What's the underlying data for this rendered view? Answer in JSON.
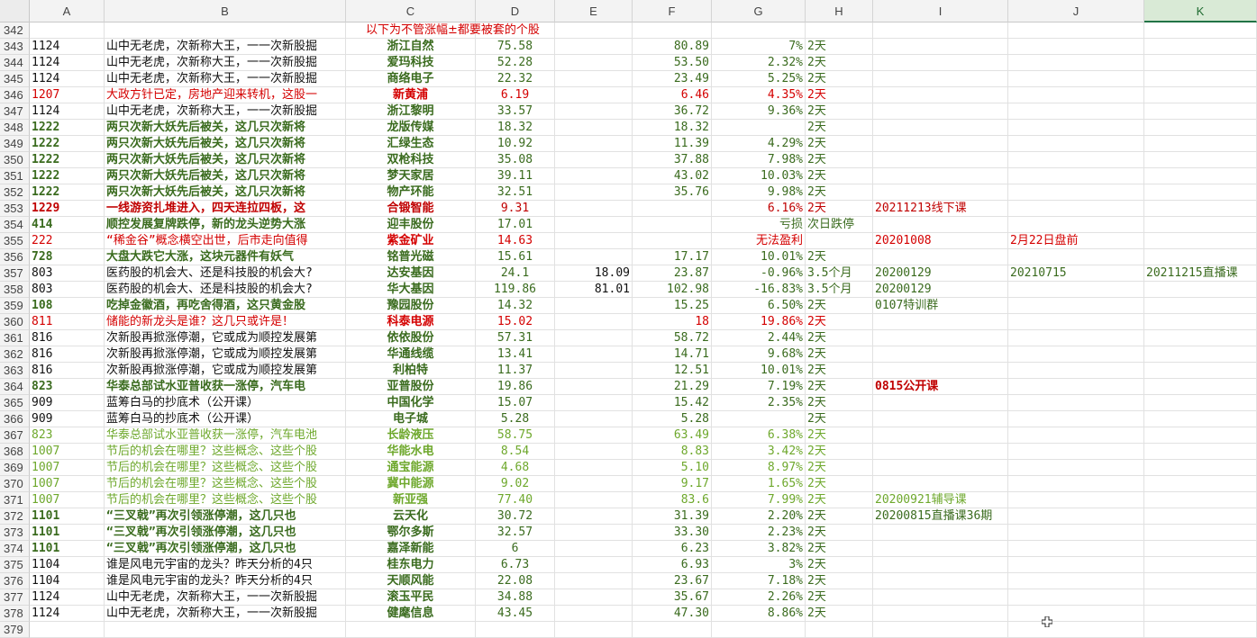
{
  "columns": [
    "A",
    "B",
    "C",
    "D",
    "E",
    "F",
    "G",
    "H",
    "I",
    "J",
    "K"
  ],
  "banner": "以下为不管涨幅±都要被套的个股",
  "rows": [
    {
      "n": "342",
      "a": "",
      "b": "",
      "c": "",
      "d": "",
      "e": "",
      "f": "",
      "g": "",
      "h": "",
      "i": "",
      "j": "",
      "k": "",
      "style": "black"
    },
    {
      "n": "343",
      "a": "1124",
      "b": "山中无老虎，次新称大王，一一次新股掘",
      "c": "浙江自然",
      "d": "75.58",
      "e": "",
      "f": "80.89",
      "g": "7%",
      "h": "2天",
      "i": "",
      "j": "",
      "k": "",
      "style": "black"
    },
    {
      "n": "344",
      "a": "1124",
      "b": "山中无老虎，次新称大王，一一次新股掘",
      "c": "爱玛科技",
      "d": "52.28",
      "e": "",
      "f": "53.50",
      "g": "2.32%",
      "h": "2天",
      "i": "",
      "j": "",
      "k": "",
      "style": "black"
    },
    {
      "n": "345",
      "a": "1124",
      "b": "山中无老虎，次新称大王，一一次新股掘",
      "c": "商络电子",
      "d": "22.32",
      "e": "",
      "f": "23.49",
      "g": "5.25%",
      "h": "2天",
      "i": "",
      "j": "",
      "k": "",
      "style": "black"
    },
    {
      "n": "346",
      "a": "1207",
      "b": "大政方针已定，房地产迎来转机，这股一",
      "c": "新黄浦",
      "d": "6.19",
      "e": "",
      "f": "6.46",
      "g": "4.35%",
      "h": "2天",
      "i": "",
      "j": "",
      "k": "",
      "style": "red"
    },
    {
      "n": "347",
      "a": "1124",
      "b": "山中无老虎，次新称大王，一一次新股掘",
      "c": "浙江黎明",
      "d": "33.57",
      "e": "",
      "f": "36.72",
      "g": "9.36%",
      "h": "2天",
      "i": "",
      "j": "",
      "k": "",
      "style": "black"
    },
    {
      "n": "348",
      "a": "1222",
      "b": "两只次新大妖先后被关，这几只次新将",
      "c": "龙版传媒",
      "d": "18.32",
      "e": "",
      "f": "18.32",
      "g": "",
      "h": "2天",
      "i": "",
      "j": "",
      "k": "",
      "style": "green"
    },
    {
      "n": "349",
      "a": "1222",
      "b": "两只次新大妖先后被关，这几只次新将",
      "c": "汇绿生态",
      "d": "10.92",
      "e": "",
      "f": "11.39",
      "g": "4.29%",
      "h": "2天",
      "i": "",
      "j": "",
      "k": "",
      "style": "green"
    },
    {
      "n": "350",
      "a": "1222",
      "b": "两只次新大妖先后被关，这几只次新将",
      "c": "双枪科技",
      "d": "35.08",
      "e": "",
      "f": "37.88",
      "g": "7.98%",
      "h": "2天",
      "i": "",
      "j": "",
      "k": "",
      "style": "green"
    },
    {
      "n": "351",
      "a": "1222",
      "b": "两只次新大妖先后被关，这几只次新将",
      "c": "梦天家居",
      "d": "39.11",
      "e": "",
      "f": "43.02",
      "g": "10.03%",
      "h": "2天",
      "i": "",
      "j": "",
      "k": "",
      "style": "green"
    },
    {
      "n": "352",
      "a": "1222",
      "b": "两只次新大妖先后被关，这几只次新将",
      "c": "物产环能",
      "d": "32.51",
      "e": "",
      "f": "35.76",
      "g": "9.98%",
      "h": "2天",
      "i": "",
      "j": "",
      "k": "",
      "style": "green"
    },
    {
      "n": "353",
      "a": "1229",
      "b": "一线游资扎堆进入，四天连拉四板，这",
      "c": "合锻智能",
      "d": "9.31",
      "e": "",
      "f": "",
      "g": "6.16%",
      "h": "2天",
      "i": "20211213线下课",
      "j": "",
      "k": "",
      "style": "redbold"
    },
    {
      "n": "354",
      "a": "414",
      "b": "顺控发展复牌跌停，新的龙头逆势大涨",
      "c": "迎丰股份",
      "d": "17.01",
      "e": "",
      "f": "",
      "g": "亏损",
      "h": "次日跌停",
      "i": "",
      "j": "",
      "k": "",
      "style": "green"
    },
    {
      "n": "355",
      "a": "222",
      "b": "“稀金谷”概念横空出世，后市走向值得",
      "c": "紫金矿业",
      "d": "14.63",
      "e": "",
      "f": "",
      "g": "无法盈利",
      "h": "",
      "i": "20201008",
      "j": "2月22日盘前",
      "k": "",
      "style": "red"
    },
    {
      "n": "356",
      "a": "728",
      "b": "大盘大跌它大涨，这块元器件有妖气",
      "c": "铭普光磁",
      "d": "15.61",
      "e": "",
      "f": "17.17",
      "g": "10.01%",
      "h": "2天",
      "i": "",
      "j": "",
      "k": "",
      "style": "green"
    },
    {
      "n": "357",
      "a": "803",
      "b": "医药股的机会大、还是科技股的机会大?",
      "c": "达安基因",
      "d": "24.1",
      "e": "18.09",
      "f": "23.87",
      "g": "-0.96%",
      "h": "3.5个月",
      "i": "20200129",
      "j": "20210715",
      "k": "20211215直播课",
      "style": "black"
    },
    {
      "n": "358",
      "a": "803",
      "b": "医药股的机会大、还是科技股的机会大?",
      "c": "华大基因",
      "d": "119.86",
      "e": "81.01",
      "f": "102.98",
      "g": "-16.83%",
      "h": "3.5个月",
      "i": "20200129",
      "j": "",
      "k": "",
      "style": "black"
    },
    {
      "n": "359",
      "a": "108",
      "b": "吃掉金徽酒，再吃舍得酒，这只黄金股",
      "c": "豫园股份",
      "d": "14.32",
      "e": "",
      "f": "15.25",
      "g": "6.50%",
      "h": "2天",
      "i": "0107特训群",
      "j": "",
      "k": "",
      "style": "green"
    },
    {
      "n": "360",
      "a": "811",
      "b": "储能的新龙头是谁？这几只或许是！",
      "c": "科泰电源",
      "d": "15.02",
      "e": "",
      "f": "18",
      "g": "19.86%",
      "h": "2天",
      "i": "",
      "j": "",
      "k": "",
      "style": "red"
    },
    {
      "n": "361",
      "a": "816",
      "b": "次新股再掀涨停潮，它或成为顺控发展第",
      "c": "依依股份",
      "d": "57.31",
      "e": "",
      "f": "58.72",
      "g": "2.44%",
      "h": "2天",
      "i": "",
      "j": "",
      "k": "",
      "style": "black"
    },
    {
      "n": "362",
      "a": "816",
      "b": "次新股再掀涨停潮，它或成为顺控发展第",
      "c": "华通线缆",
      "d": "13.41",
      "e": "",
      "f": "14.71",
      "g": "9.68%",
      "h": "2天",
      "i": "",
      "j": "",
      "k": "",
      "style": "black"
    },
    {
      "n": "363",
      "a": "816",
      "b": "次新股再掀涨停潮，它或成为顺控发展第",
      "c": "利柏特",
      "d": "11.37",
      "e": "",
      "f": "12.51",
      "g": "10.01%",
      "h": "2天",
      "i": "",
      "j": "",
      "k": "",
      "style": "black"
    },
    {
      "n": "364",
      "a": "823",
      "b": "华泰总部试水亚普收获一涨停，汽车电",
      "c": "亚普股份",
      "d": "19.86",
      "e": "",
      "f": "21.29",
      "g": "7.19%",
      "h": "2天",
      "i": "0815公开课",
      "j": "",
      "k": "",
      "style": "green"
    },
    {
      "n": "365",
      "a": "909",
      "b": "蓝筹白马的抄底术（公开课）",
      "c": "中国化学",
      "d": "15.07",
      "e": "",
      "f": "15.42",
      "g": "2.35%",
      "h": "2天",
      "i": "",
      "j": "",
      "k": "",
      "style": "black"
    },
    {
      "n": "366",
      "a": "909",
      "b": "蓝筹白马的抄底术（公开课）",
      "c": "电子城",
      "d": "5.28",
      "e": "",
      "f": "5.28",
      "g": "",
      "h": "2天",
      "i": "",
      "j": "",
      "k": "",
      "style": "black"
    },
    {
      "n": "367",
      "a": "823",
      "b": "华泰总部试水亚普收获一涨停，汽车电池",
      "c": "长龄液压",
      "d": "58.75",
      "e": "",
      "f": "63.49",
      "g": "6.38%",
      "h": "2天",
      "i": "",
      "j": "",
      "k": "",
      "style": "lgreen"
    },
    {
      "n": "368",
      "a": "1007",
      "b": "节后的机会在哪里？这些概念、这些个股",
      "c": "华能水电",
      "d": "8.54",
      "e": "",
      "f": "8.83",
      "g": "3.42%",
      "h": "2天",
      "i": "",
      "j": "",
      "k": "",
      "style": "lgreen"
    },
    {
      "n": "369",
      "a": "1007",
      "b": "节后的机会在哪里？这些概念、这些个股",
      "c": "通宝能源",
      "d": "4.68",
      "e": "",
      "f": "5.10",
      "g": "8.97%",
      "h": "2天",
      "i": "",
      "j": "",
      "k": "",
      "style": "lgreen"
    },
    {
      "n": "370",
      "a": "1007",
      "b": "节后的机会在哪里？这些概念、这些个股",
      "c": "冀中能源",
      "d": "9.02",
      "e": "",
      "f": "9.17",
      "g": "1.65%",
      "h": "2天",
      "i": "",
      "j": "",
      "k": "",
      "style": "lgreen"
    },
    {
      "n": "371",
      "a": "1007",
      "b": "节后的机会在哪里？这些概念、这些个股",
      "c": "新亚强",
      "d": "77.40",
      "e": "",
      "f": "83.6",
      "g": "7.99%",
      "h": "2天",
      "i": "20200921辅导课",
      "j": "",
      "k": "",
      "style": "lgreen"
    },
    {
      "n": "372",
      "a": "1101",
      "b": "“三叉戟”再次引领涨停潮，这几只也",
      "c": "云天化",
      "d": "30.72",
      "e": "",
      "f": "31.39",
      "g": "2.20%",
      "h": "2天",
      "i": "20200815直播课36期",
      "j": "",
      "k": "",
      "style": "green"
    },
    {
      "n": "373",
      "a": "1101",
      "b": "“三叉戟”再次引领涨停潮，这几只也",
      "c": "鄂尔多斯",
      "d": "32.57",
      "e": "",
      "f": "33.30",
      "g": "2.23%",
      "h": "2天",
      "i": "",
      "j": "",
      "k": "",
      "style": "green"
    },
    {
      "n": "374",
      "a": "1101",
      "b": "“三叉戟”再次引领涨停潮，这几只也",
      "c": "嘉泽新能",
      "d": "6",
      "e": "",
      "f": "6.23",
      "g": "3.82%",
      "h": "2天",
      "i": "",
      "j": "",
      "k": "",
      "style": "green"
    },
    {
      "n": "375",
      "a": "1104",
      "b": "谁是风电元宇宙的龙头？昨天分析的4只",
      "c": "桂东电力",
      "d": "6.73",
      "e": "",
      "f": "6.93",
      "g": "3%",
      "h": "2天",
      "i": "",
      "j": "",
      "k": "",
      "style": "black"
    },
    {
      "n": "376",
      "a": "1104",
      "b": "谁是风电元宇宙的龙头？昨天分析的4只",
      "c": "天顺风能",
      "d": "22.08",
      "e": "",
      "f": "23.67",
      "g": "7.18%",
      "h": "2天",
      "i": "",
      "j": "",
      "k": "",
      "style": "black"
    },
    {
      "n": "377",
      "a": "1124",
      "b": "山中无老虎，次新称大王，一一次新股掘",
      "c": "滚玉平民",
      "d": "34.88",
      "e": "",
      "f": "35.67",
      "g": "2.26%",
      "h": "2天",
      "i": "",
      "j": "",
      "k": "",
      "style": "black"
    },
    {
      "n": "378",
      "a": "1124",
      "b": "山中无老虎，次新称大王，一一次新股掘",
      "c": "健麾信息",
      "d": "43.45",
      "e": "",
      "f": "47.30",
      "g": "8.86%",
      "h": "2天",
      "i": "",
      "j": "",
      "k": "",
      "style": "black"
    },
    {
      "n": "379",
      "a": "",
      "b": "",
      "c": "",
      "d": "",
      "e": "",
      "f": "",
      "g": "",
      "h": "",
      "i": "",
      "j": "",
      "k": "",
      "style": "black"
    }
  ],
  "selected_column": "K",
  "cursor_icon": "crosshair-cursor-icon"
}
